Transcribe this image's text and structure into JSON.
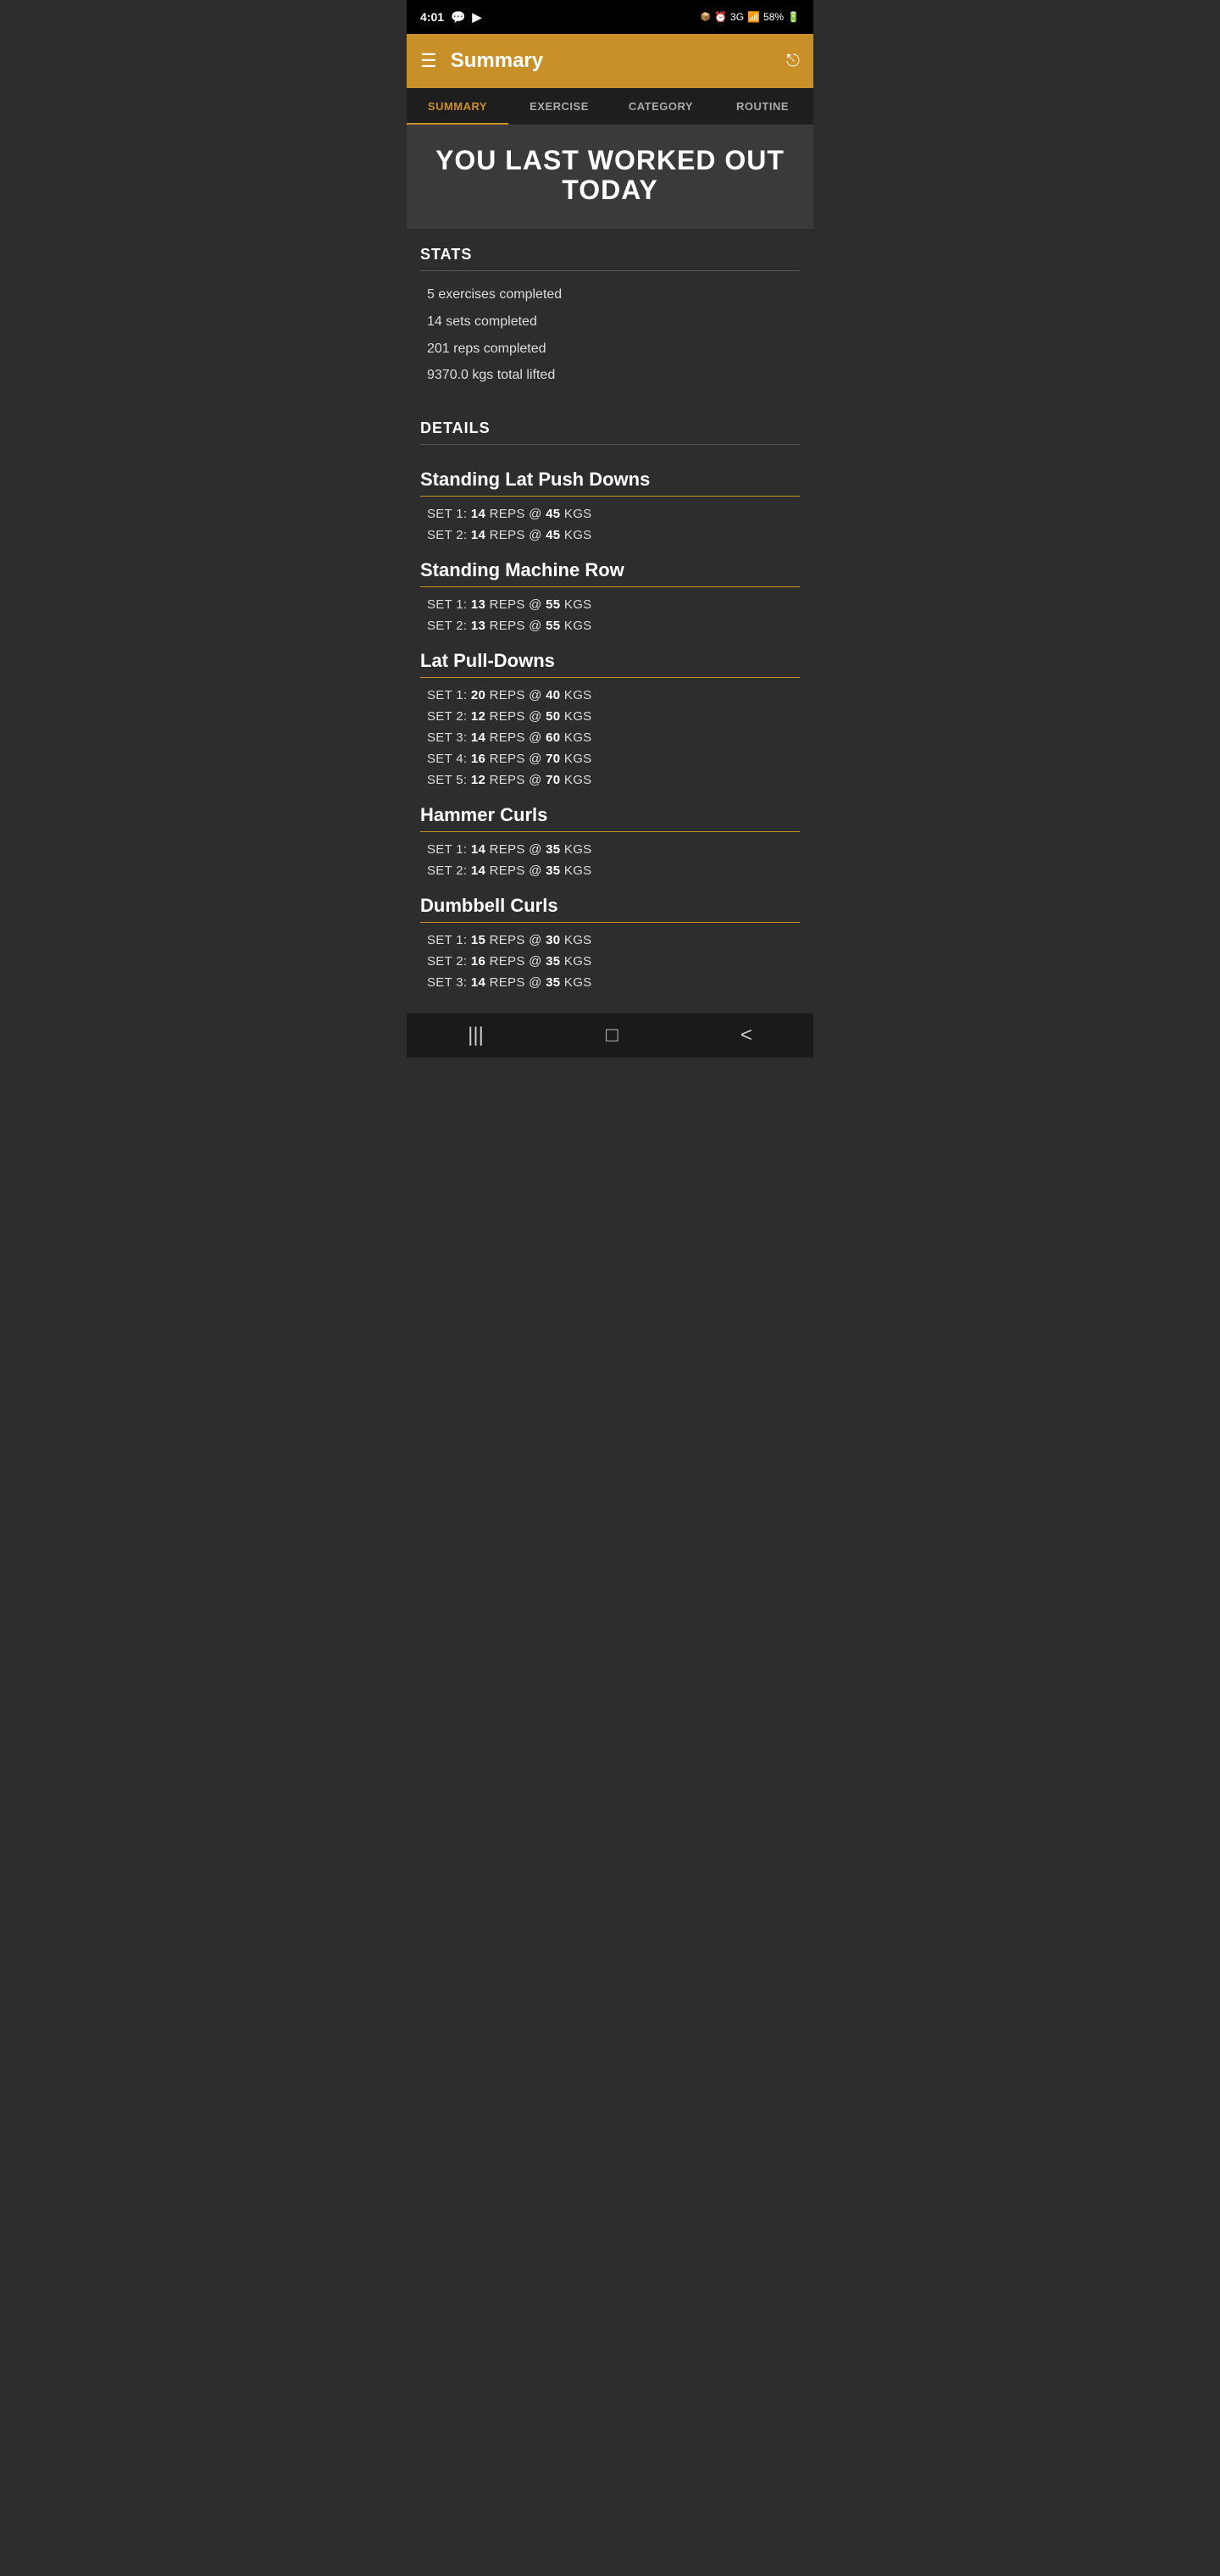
{
  "statusBar": {
    "time": "4:01",
    "battery": "58%",
    "network": "3G"
  },
  "header": {
    "title": "Summary",
    "menuIcon": "☰",
    "shareIcon": "⎋"
  },
  "tabs": [
    {
      "id": "summary",
      "label": "SUMMARY",
      "active": true
    },
    {
      "id": "exercise",
      "label": "EXERCISE",
      "active": false
    },
    {
      "id": "category",
      "label": "CATEGORY",
      "active": false
    },
    {
      "id": "routine",
      "label": "ROUTINE",
      "active": false
    }
  ],
  "hero": {
    "text": "YOU LAST WORKED OUT TODAY"
  },
  "stats": {
    "title": "STATS",
    "items": [
      "5 exercises completed",
      "14 sets completed",
      "201 reps completed",
      "9370.0 kgs total lifted"
    ]
  },
  "details": {
    "title": "DETAILS",
    "exercises": [
      {
        "name": "Standing Lat Push Downs",
        "sets": [
          "SET 1: 14 REPS @ 45 KGS",
          "SET 2: 14 REPS @ 45 KGS"
        ]
      },
      {
        "name": "Standing Machine Row",
        "sets": [
          "SET 1: 13 REPS @ 55 KGS",
          "SET 2: 13 REPS @ 55 KGS"
        ]
      },
      {
        "name": "Lat Pull-Downs",
        "sets": [
          "SET 1: 20 REPS @ 40 KGS",
          "SET 2: 12 REPS @ 50 KGS",
          "SET 3: 14 REPS @ 60 KGS",
          "SET 4: 16 REPS @ 70 KGS",
          "SET 5: 12 REPS @ 70 KGS"
        ]
      },
      {
        "name": "Hammer Curls",
        "sets": [
          "SET 1: 14 REPS @ 35 KGS",
          "SET 2: 14 REPS @ 35 KGS"
        ]
      },
      {
        "name": "Dumbbell Curls",
        "sets": [
          "SET 1: 15 REPS @ 30 KGS",
          "SET 2: 16 REPS @ 35 KGS",
          "SET 3: 14 REPS @ 35 KGS"
        ]
      }
    ]
  },
  "bottomNav": {
    "icons": [
      "|||",
      "□",
      "<"
    ]
  }
}
